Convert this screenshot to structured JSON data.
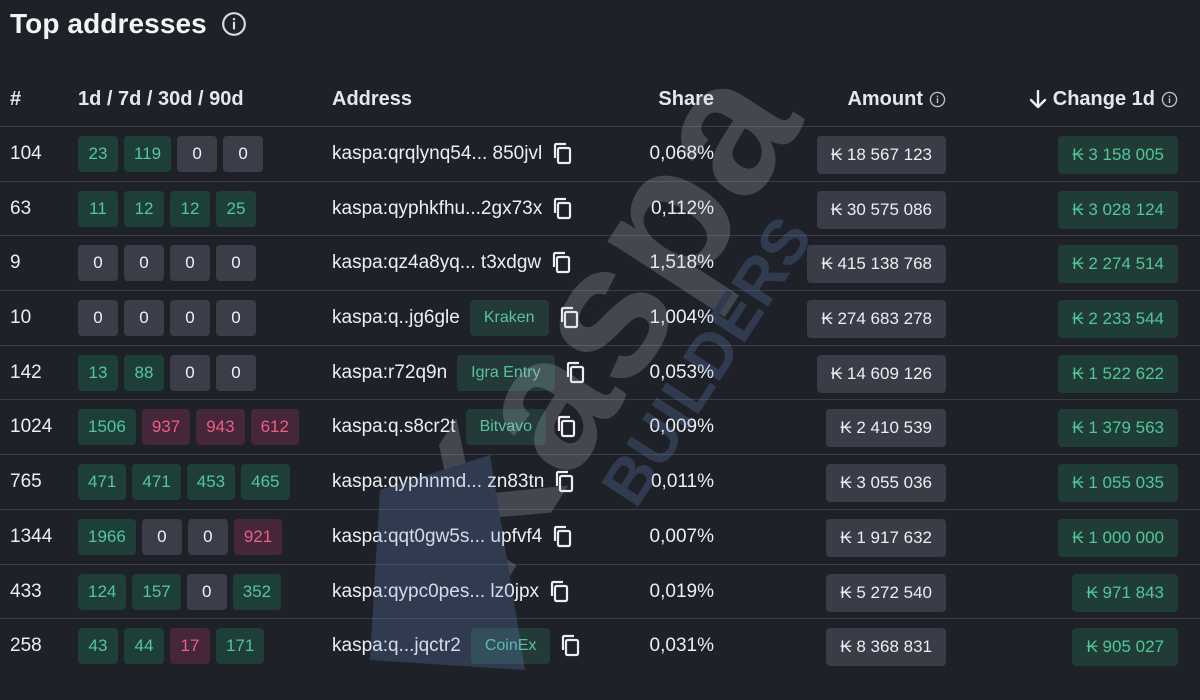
{
  "header": {
    "title": "Top addresses",
    "info_icon": "info-circle-icon"
  },
  "columns": {
    "rank": "#",
    "activity": "1d / 7d / 30d / 90d",
    "address": "Address",
    "share": "Share",
    "amount": "Amount",
    "change": "Change 1d",
    "sort_icon": "arrow-down-icon"
  },
  "colors": {
    "background": "#1f2129",
    "positive": "#54c69c",
    "negative": "#ec5f86",
    "neutral_chip": "#3b3d48"
  },
  "rows": [
    {
      "rank": "104",
      "activity": [
        {
          "v": "23",
          "s": "pos"
        },
        {
          "v": "119",
          "s": "pos"
        },
        {
          "v": "0",
          "s": "zero"
        },
        {
          "v": "0",
          "s": "zero"
        }
      ],
      "address": "kaspa:qrqlynq54... 850jvl",
      "tag": "",
      "share": "0,068%",
      "amount": "₭ 18 567 123",
      "change": "₭ 3 158 005"
    },
    {
      "rank": "63",
      "activity": [
        {
          "v": "11",
          "s": "pos"
        },
        {
          "v": "12",
          "s": "pos"
        },
        {
          "v": "12",
          "s": "pos"
        },
        {
          "v": "25",
          "s": "pos"
        }
      ],
      "address": "kaspa:qyphkfhu...2gx73x",
      "tag": "",
      "share": "0,112%",
      "amount": "₭ 30 575 086",
      "change": "₭ 3 028 124"
    },
    {
      "rank": "9",
      "activity": [
        {
          "v": "0",
          "s": "zero"
        },
        {
          "v": "0",
          "s": "zero"
        },
        {
          "v": "0",
          "s": "zero"
        },
        {
          "v": "0",
          "s": "zero"
        }
      ],
      "address": "kaspa:qz4a8yq... t3xdgw",
      "tag": "",
      "share": "1,518%",
      "amount": "₭ 415 138 768",
      "change": "₭ 2 274 514"
    },
    {
      "rank": "10",
      "activity": [
        {
          "v": "0",
          "s": "zero"
        },
        {
          "v": "0",
          "s": "zero"
        },
        {
          "v": "0",
          "s": "zero"
        },
        {
          "v": "0",
          "s": "zero"
        }
      ],
      "address": "kaspa:q..jg6gle",
      "tag": "Kraken",
      "share": "1,004%",
      "amount": "₭ 274 683 278",
      "change": "₭ 2 233 544"
    },
    {
      "rank": "142",
      "activity": [
        {
          "v": "13",
          "s": "pos"
        },
        {
          "v": "88",
          "s": "pos"
        },
        {
          "v": "0",
          "s": "zero"
        },
        {
          "v": "0",
          "s": "zero"
        }
      ],
      "address": "kaspa:r72q9n",
      "tag": "Igra Entry",
      "share": "0,053%",
      "amount": "₭ 14 609 126",
      "change": "₭ 1 522 622"
    },
    {
      "rank": "1024",
      "activity": [
        {
          "v": "1506",
          "s": "pos"
        },
        {
          "v": "937",
          "s": "neg"
        },
        {
          "v": "943",
          "s": "neg"
        },
        {
          "v": "612",
          "s": "neg"
        }
      ],
      "address": "kaspa:q.s8cr2t",
      "tag": "Bitvavo",
      "share": "0,009%",
      "amount": "₭ 2 410 539",
      "change": "₭ 1 379 563"
    },
    {
      "rank": "765",
      "activity": [
        {
          "v": "471",
          "s": "pos"
        },
        {
          "v": "471",
          "s": "pos"
        },
        {
          "v": "453",
          "s": "pos"
        },
        {
          "v": "465",
          "s": "pos"
        }
      ],
      "address": "kaspa:qyphnmd... zn83tn",
      "tag": "",
      "share": "0,011%",
      "amount": "₭ 3 055 036",
      "change": "₭ 1 055 035"
    },
    {
      "rank": "1344",
      "activity": [
        {
          "v": "1966",
          "s": "pos"
        },
        {
          "v": "0",
          "s": "zero"
        },
        {
          "v": "0",
          "s": "zero"
        },
        {
          "v": "921",
          "s": "neg"
        }
      ],
      "address": "kaspa:qqt0gw5s... upfvf4",
      "tag": "",
      "share": "0,007%",
      "amount": "₭ 1 917 632",
      "change": "₭ 1 000 000"
    },
    {
      "rank": "433",
      "activity": [
        {
          "v": "124",
          "s": "pos"
        },
        {
          "v": "157",
          "s": "pos"
        },
        {
          "v": "0",
          "s": "zero"
        },
        {
          "v": "352",
          "s": "pos"
        }
      ],
      "address": "kaspa:qypc0pes... lz0jpx",
      "tag": "",
      "share": "0,019%",
      "amount": "₭ 5 272 540",
      "change": "₭ 971 843"
    },
    {
      "rank": "258",
      "activity": [
        {
          "v": "43",
          "s": "pos"
        },
        {
          "v": "44",
          "s": "pos"
        },
        {
          "v": "17",
          "s": "neg"
        },
        {
          "v": "171",
          "s": "pos"
        }
      ],
      "address": "kaspa:q...jqctr2",
      "tag": "CoinEx",
      "share": "0,031%",
      "amount": "₭ 8 368 831",
      "change": "₭ 905 027"
    }
  ],
  "watermark": {
    "brand": "Kaspa",
    "sub": "BUILDERS"
  }
}
